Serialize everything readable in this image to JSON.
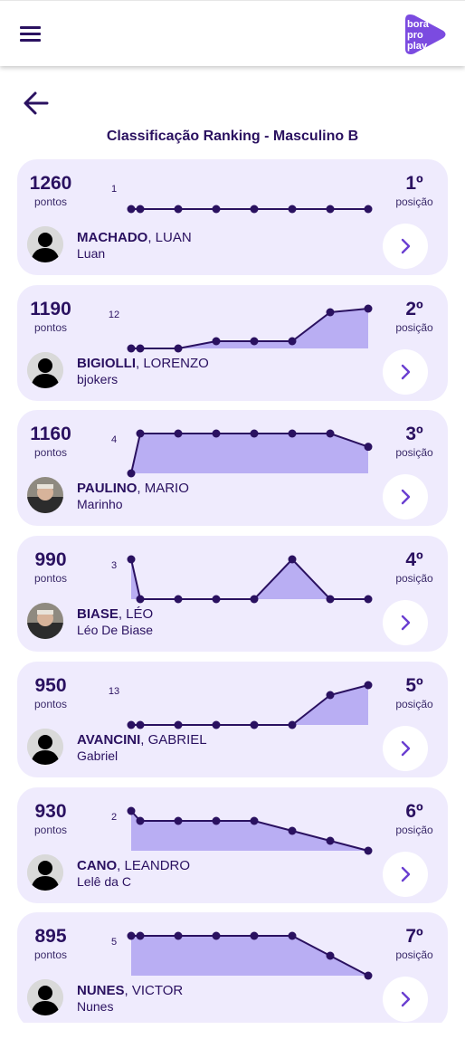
{
  "header": {
    "menu_icon": "hamburger-menu-icon",
    "logo_lines": [
      "bora",
      "pro",
      "play"
    ],
    "brand_color": "#7b4be0"
  },
  "back_icon": "arrow-left-icon",
  "page_title": "Classificação Ranking - Masculino B",
  "colors": {
    "dark": "#2a1160",
    "card": "#efebfd",
    "fill": "#b9aef3"
  },
  "ranking": [
    {
      "points": "1260",
      "points_label": "pontos",
      "games": "1",
      "position": "1º",
      "position_label": "posição",
      "last_name": "MACHADO",
      "first_name": ", LUAN",
      "nickname": "Luan",
      "photo": "default",
      "history": [
        1,
        1,
        1,
        1,
        1,
        1,
        1,
        1
      ]
    },
    {
      "points": "1190",
      "points_label": "pontos",
      "games": "12",
      "position": "2º",
      "position_label": "posição",
      "last_name": "BIGIOLLI",
      "first_name": ", LORENZO",
      "nickname": "bjokers",
      "photo": "default",
      "history": [
        12,
        12,
        12,
        10,
        10,
        10,
        2,
        1
      ]
    },
    {
      "points": "1160",
      "points_label": "pontos",
      "games": "4",
      "position": "3º",
      "position_label": "posição",
      "last_name": "PAULINO",
      "first_name": ", MARIO",
      "nickname": "Marinho",
      "photo": "photo",
      "history": [
        4,
        1,
        1,
        1,
        1,
        1,
        1,
        2
      ]
    },
    {
      "points": "990",
      "points_label": "pontos",
      "games": "3",
      "position": "4º",
      "position_label": "posição",
      "last_name": "BIASE",
      "first_name": ", LÉO",
      "nickname": "Léo De Biase",
      "photo": "photo",
      "history": [
        3,
        4,
        4,
        4,
        4,
        3,
        4,
        4
      ]
    },
    {
      "points": "950",
      "points_label": "pontos",
      "games": "13",
      "position": "5º",
      "position_label": "posição",
      "last_name": "AVANCINI",
      "first_name": ", GABRIEL",
      "nickname": "Gabriel",
      "photo": "default",
      "history": [
        13,
        13,
        13,
        13,
        13,
        13,
        7,
        5
      ]
    },
    {
      "points": "930",
      "points_label": "pontos",
      "games": "2",
      "position": "6º",
      "position_label": "posição",
      "last_name": "CANO",
      "first_name": ", LEANDRO",
      "nickname": "Lelê da C",
      "photo": "default",
      "history": [
        2,
        3,
        3,
        3,
        3,
        4,
        5,
        6
      ]
    },
    {
      "points": "895",
      "points_label": "pontos",
      "games": "5",
      "position": "7º",
      "position_label": "posição",
      "last_name": "NUNES",
      "first_name": ", VICTOR",
      "nickname": "Nunes",
      "photo": "default",
      "history": [
        5,
        5,
        5,
        5,
        5,
        5,
        6,
        7
      ]
    }
  ]
}
